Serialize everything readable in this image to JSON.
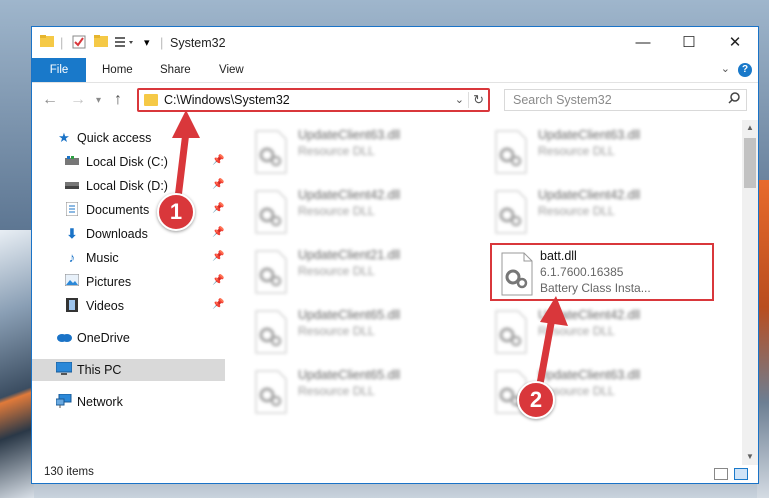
{
  "window": {
    "title": "System32",
    "controls": {
      "minimize": "—",
      "maximize": "☐",
      "close": "✕"
    }
  },
  "ribbon": {
    "tabs": [
      {
        "label": "File"
      },
      {
        "label": "Home"
      },
      {
        "label": "Share"
      },
      {
        "label": "View"
      }
    ],
    "help": "?"
  },
  "navigation": {
    "address": "C:\\Windows\\System32",
    "search_placeholder": "Search System32"
  },
  "sidebar": {
    "items": [
      {
        "label": "Quick access",
        "icon": "star-icon"
      },
      {
        "label": "Local Disk (C:)",
        "icon": "drive-icon"
      },
      {
        "label": "Local Disk (D:)",
        "icon": "drive-icon"
      },
      {
        "label": "Documents",
        "icon": "documents-icon"
      },
      {
        "label": "Downloads",
        "icon": "download-icon"
      },
      {
        "label": "Music",
        "icon": "music-icon"
      },
      {
        "label": "Pictures",
        "icon": "pictures-icon"
      },
      {
        "label": "Videos",
        "icon": "videos-icon"
      },
      {
        "label": "OneDrive",
        "icon": "cloud-icon"
      },
      {
        "label": "This PC",
        "icon": "computer-icon",
        "selected": true
      },
      {
        "label": "Network",
        "icon": "network-icon"
      }
    ]
  },
  "files": {
    "blurred": [
      {
        "name": "UpdateClient63.dll",
        "desc": "Resource DLL"
      },
      {
        "name": "UpdateClient63.dll",
        "desc": "Resource DLL"
      },
      {
        "name": "UpdateClient42.dll",
        "desc": "Resource DLL"
      },
      {
        "name": "UpdateClient42.dll",
        "desc": "Resource DLL"
      },
      {
        "name": "UpdateClient21.dll",
        "desc": "Resource DLL"
      },
      {
        "name": "UpdateClient65.dll",
        "desc": "Resource DLL"
      },
      {
        "name": "UpdateClient42.dll",
        "desc": "Resource DLL"
      },
      {
        "name": "UpdateClient65.dll",
        "desc": "Resource DLL"
      },
      {
        "name": "UpdateClient63.dll",
        "desc": "Resource DLL"
      }
    ],
    "highlighted": {
      "name": "batt.dll",
      "version": "6.1.7600.16385",
      "desc": "Battery Class Insta..."
    }
  },
  "status": {
    "count": "130 items"
  },
  "annotations": {
    "badge1": "1",
    "badge2": "2",
    "color": "#d9373b"
  }
}
